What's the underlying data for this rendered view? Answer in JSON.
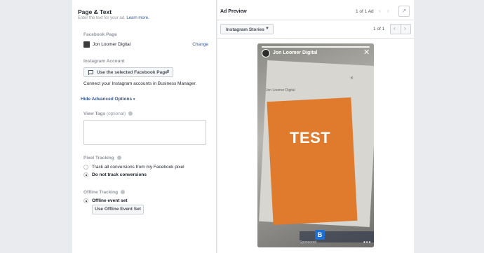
{
  "left_panel": {
    "title": "Page & Text",
    "subtitle": "Enter the text for your ad.",
    "learn_more": "Learn more.",
    "facebook_page_label": "Facebook Page",
    "page_name": "Jon Loomer Digital",
    "change_link": "Change",
    "instagram_account_label": "Instagram Account",
    "instagram_select": "Use the selected Facebook Page",
    "connect_text": "Connect your Instagram accounts in Business Manager.",
    "advanced_link": "Hide Advanced Options",
    "view_tags_label": "View Tags",
    "view_tags_optional": "(optional)",
    "pixel_tracking_label": "Pixel Tracking",
    "pixel_options": [
      {
        "label": "Track all conversions from my Facebook pixel",
        "selected": false
      },
      {
        "label": "Do not track conversions",
        "selected": true
      }
    ],
    "offline_tracking_label": "Offline Tracking",
    "offline_option": "Offline event set",
    "offline_button": "Use Offline Event Set"
  },
  "right_panel": {
    "title": "Ad Preview",
    "ad_count": "1 of 1 Ad",
    "placement": "Instagram Stories",
    "page_count": "1 of 1",
    "story": {
      "account_name": "Jon Loomer Digital",
      "inner_account_name": "Jon Loomer Digital",
      "headline": "TEST",
      "sponsored": "Sponsored",
      "dock_letter": "B"
    }
  },
  "colors": {
    "link": "#365899",
    "story_orange": "#e07a2c",
    "background": "#e9ebee"
  }
}
